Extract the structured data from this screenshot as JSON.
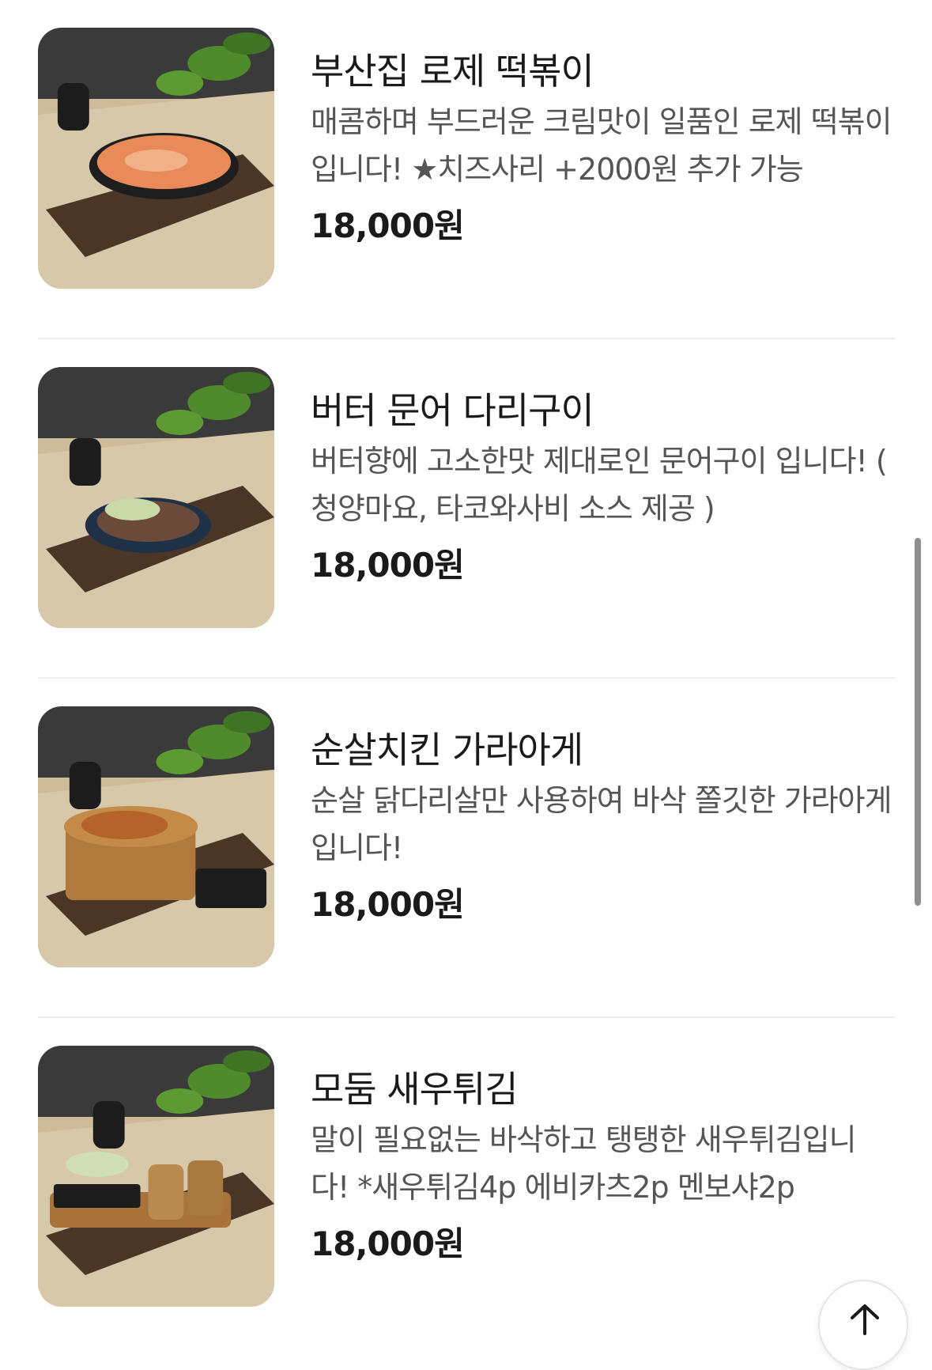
{
  "menu": {
    "items": [
      {
        "name": "부산집 로제 떡볶이",
        "description": "매콤하며 부드러운 크림맛이 일품인 로제 떡볶이 입니다! ★치즈사리 +2000원 추가 가능",
        "price": "18,000원",
        "image_icon": "rose-tteokbokki-photo"
      },
      {
        "name": "버터 문어 다리구이",
        "description": "버터향에 고소한맛 제대로인 문어구이 입니다! ( 청양마요, 타코와사비 소스 제공 )",
        "price": "18,000원",
        "image_icon": "butter-octopus-photo"
      },
      {
        "name": "순살치킨 가라아게",
        "description": "순살 닭다리살만 사용하여 바삭 쫄깃한 가라아게 입니다!",
        "price": "18,000원",
        "image_icon": "karaage-photo"
      },
      {
        "name": "모둠 새우튀김",
        "description": "말이 필요없는 바삭하고 탱탱한 새우튀김입니다! *새우튀김4p 에비카츠2p 멘보샤2p",
        "price": "18,000원",
        "image_icon": "fried-shrimp-photo"
      }
    ]
  },
  "controls": {
    "scroll_top_icon": "arrow-up-icon"
  },
  "colors": {
    "text_primary": "#1a1a1a",
    "text_secondary": "#555555",
    "divider": "#eeeeee"
  }
}
